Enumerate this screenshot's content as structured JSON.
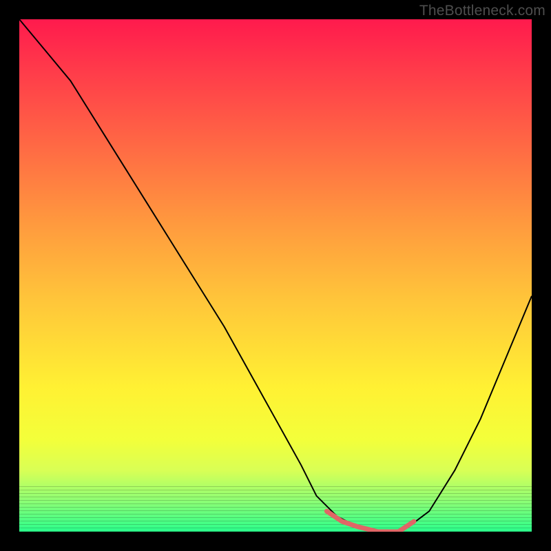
{
  "watermark": {
    "text": "TheBottleneck.com"
  },
  "chart_data": {
    "type": "line",
    "title": "",
    "xlabel": "",
    "ylabel": "",
    "xlim": [
      0,
      100
    ],
    "ylim": [
      0,
      100
    ],
    "grid": false,
    "legend": false,
    "series": [
      {
        "name": "curve",
        "x": [
          0,
          5,
          10,
          15,
          20,
          25,
          30,
          35,
          40,
          45,
          50,
          55,
          58,
          62,
          66,
          70,
          74,
          76,
          80,
          85,
          90,
          95,
          100
        ],
        "y": [
          100,
          94,
          88,
          80,
          72,
          64,
          56,
          48,
          40,
          31,
          22,
          13,
          7,
          3,
          1,
          0,
          0,
          1,
          4,
          12,
          22,
          34,
          46
        ]
      },
      {
        "name": "highlight-segment",
        "x": [
          60,
          63,
          66,
          70,
          74,
          77
        ],
        "y": [
          4,
          2,
          1,
          0,
          0,
          2
        ]
      }
    ],
    "colors": {
      "curve": "#000000",
      "highlight": "#e06666",
      "gradient_top": "#ff1a4d",
      "gradient_bottom": "#2bff8c"
    }
  }
}
